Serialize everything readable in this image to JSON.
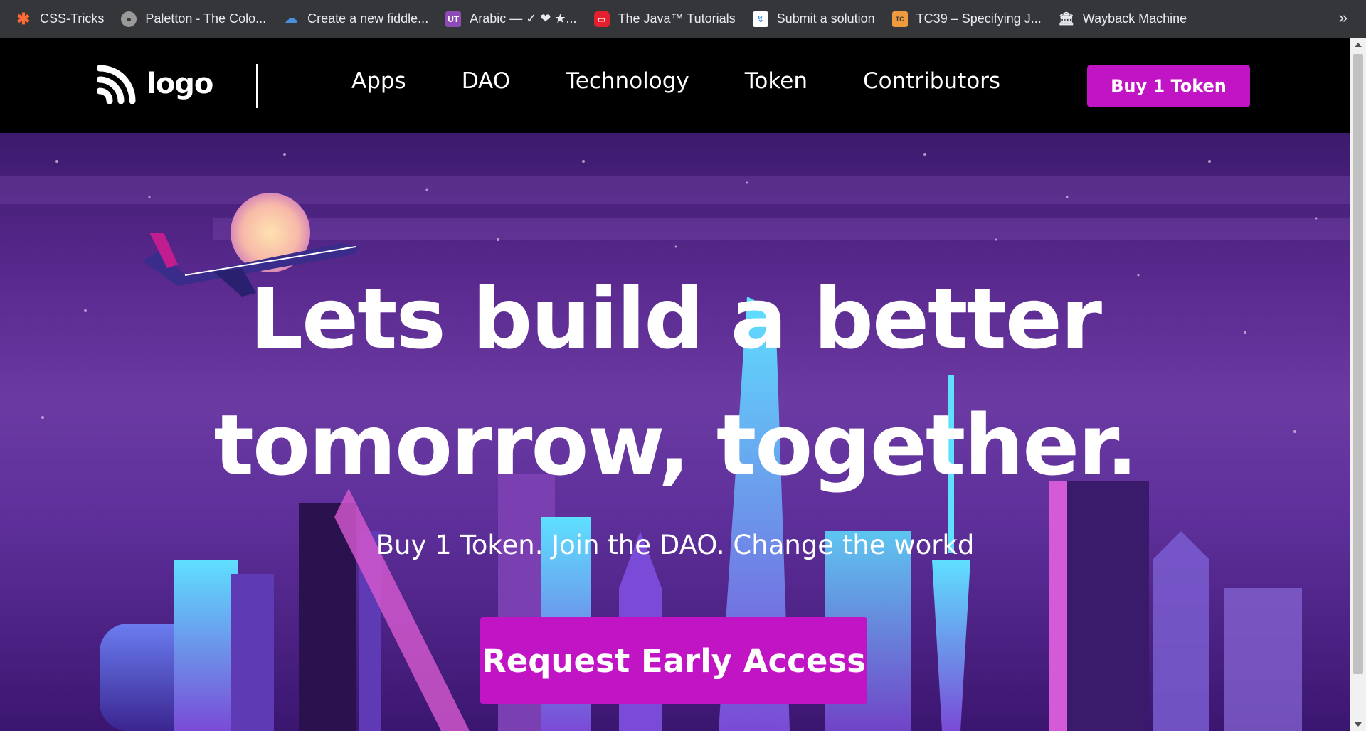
{
  "bookmarks": [
    {
      "label": "CSS-Tricks",
      "icon": "css-tricks-icon"
    },
    {
      "label": "Paletton - The Colo...",
      "icon": "paletton-icon"
    },
    {
      "label": "Create a new fiddle...",
      "icon": "jsfiddle-icon"
    },
    {
      "label": "Arabic — ✓ ❤ ★...",
      "icon": "ut-icon"
    },
    {
      "label": "The Java™ Tutorials",
      "icon": "oracle-icon"
    },
    {
      "label": "Submit a solution",
      "icon": "submit-icon"
    },
    {
      "label": "TC39 – Specifying J...",
      "icon": "tc39-icon"
    },
    {
      "label": "Wayback Machine",
      "icon": "wayback-icon"
    }
  ],
  "bookmarks_more": "»",
  "nav": {
    "logo_text": "logo",
    "links": [
      "Apps",
      "DAO",
      "Technology",
      "Token",
      "Contributors"
    ],
    "buy_button": "Buy 1 Token"
  },
  "hero": {
    "title_line1": "Lets build a better",
    "title_line2": "tomorrow, together.",
    "subtitle": "Buy 1 Token. Join the DAO. Change the workd",
    "cta": "Request Early Access"
  },
  "colors": {
    "accent": "#c115c5",
    "nav_bg": "#000000",
    "bookmarks_bg": "#35363a"
  }
}
